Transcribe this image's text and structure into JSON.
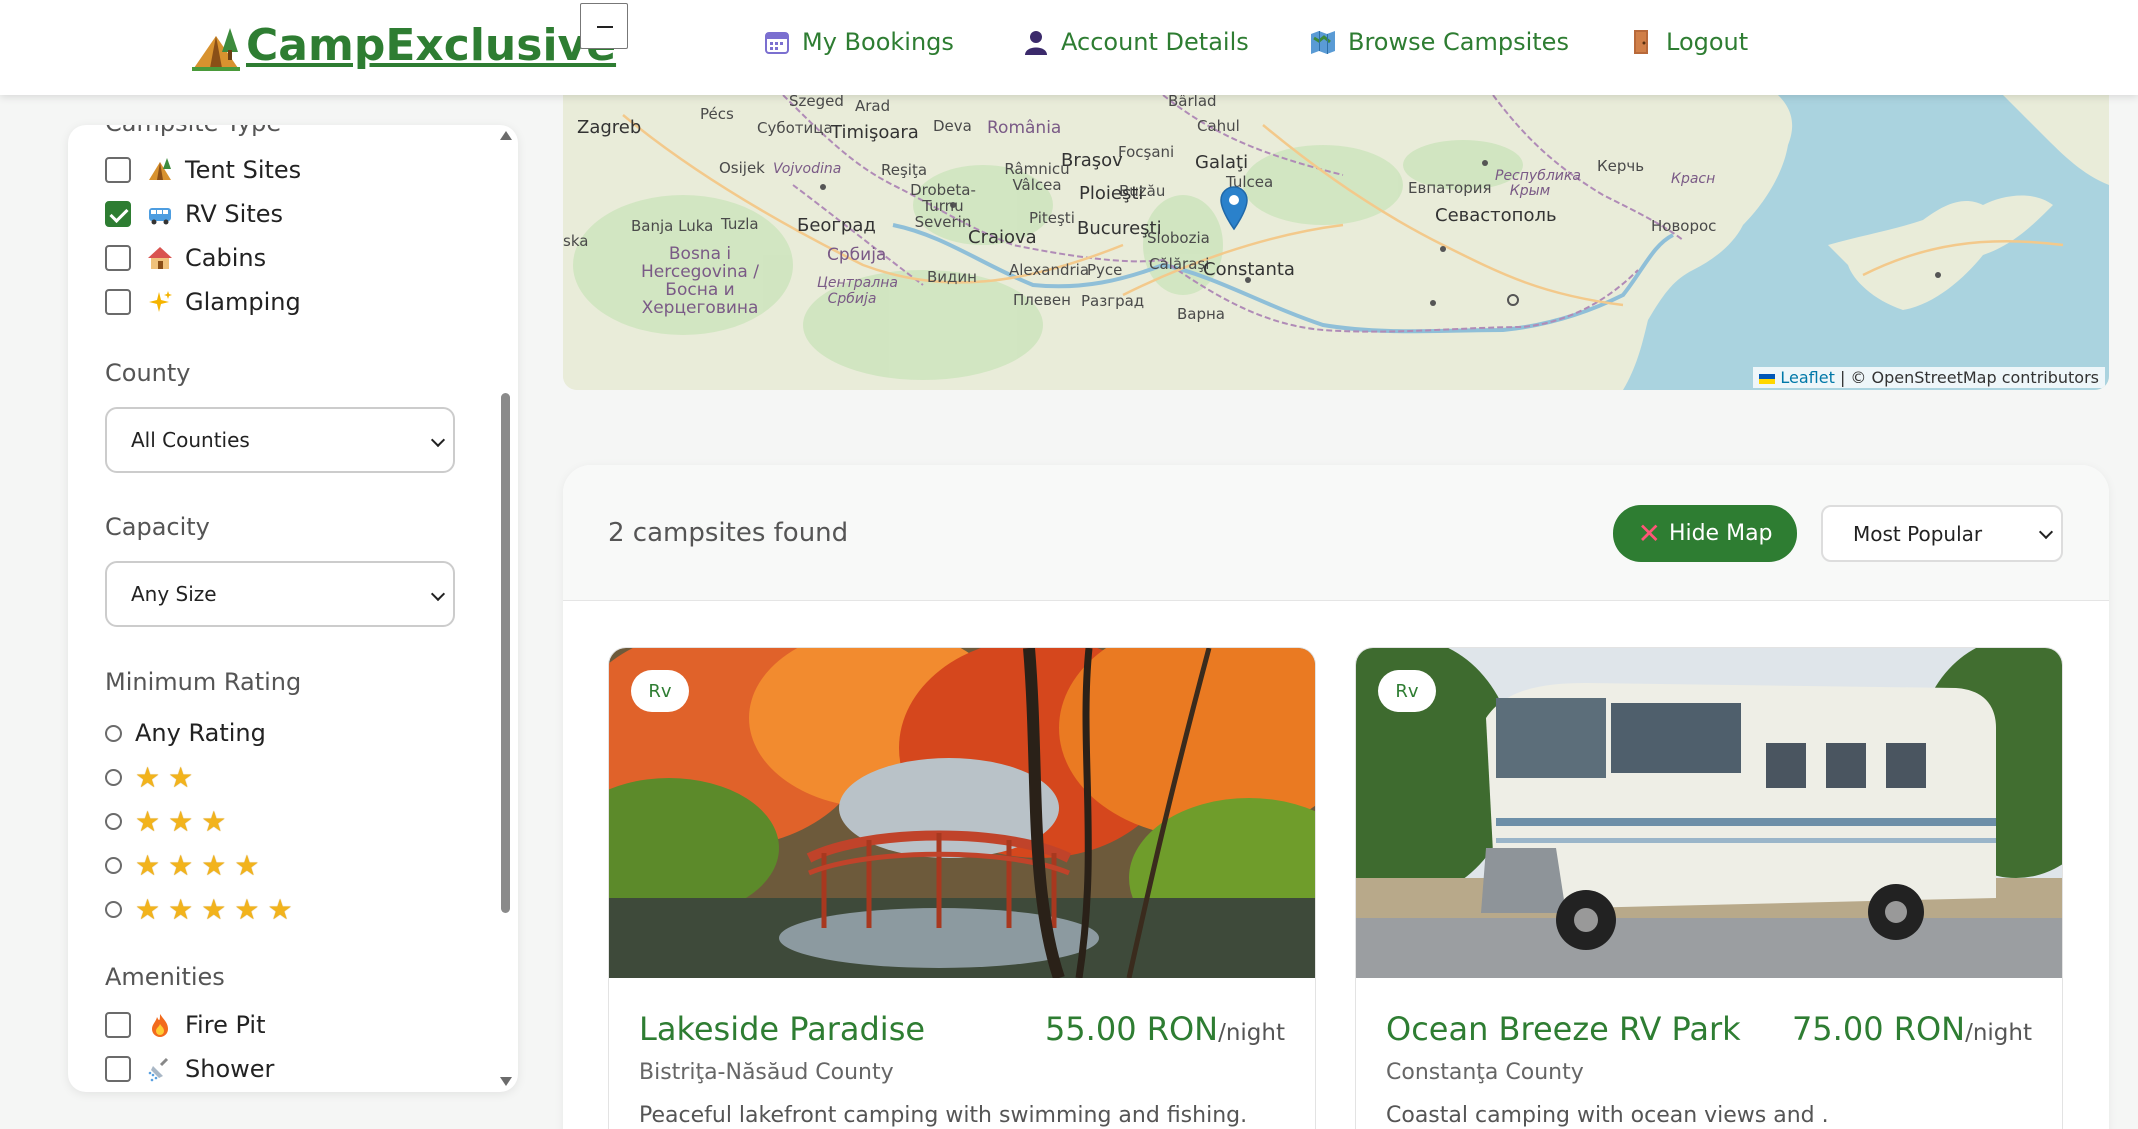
{
  "header": {
    "logo_text": "CampExclusive",
    "zoom_out": "−",
    "nav": [
      {
        "label": "My Bookings",
        "icon": "calendar-icon"
      },
      {
        "label": "Account Details",
        "icon": "person-icon"
      },
      {
        "label": "Browse Campsites",
        "icon": "map-icon"
      },
      {
        "label": "Logout",
        "icon": "door-icon"
      }
    ]
  },
  "map": {
    "labels": [
      "Szeged",
      "Arad",
      "Bârlad",
      "Pécs",
      "Zagreb",
      "Суботица",
      "Timişoara",
      "Deva",
      "România",
      "Cahul",
      "Focşani",
      "Galaţi",
      "Osijek",
      "Vojvodina",
      "Reşiţa",
      "Braşov",
      "Râmnicu Vâlcea",
      "Tulcea",
      "Buzău",
      "Drobeta-Turnu Severin",
      "Ploieşti",
      "Banja Luka",
      "Tuzla",
      "Београд",
      "Craiova",
      "Piteşti",
      "Bucureşti",
      "Slobozia",
      "Bosna i Hercegovina / Босна и Херцеговина",
      "Србија",
      "Видин",
      "Alexandria",
      "Русе",
      "Călăraşi",
      "Constanta",
      "Централна Србија",
      "Плевен",
      "Разград",
      "Варна",
      "Евпатория",
      "Республика Крым",
      "Керчь",
      "Севастополь",
      "Красн",
      "Новорос",
      "ska"
    ],
    "attribution_link": "Leaflet",
    "attribution_text": "| © OpenStreetMap contributors",
    "marker_place": "Constanta"
  },
  "sidebar": {
    "campsite_type_title": "Campsite Type",
    "types": [
      {
        "label": "Tent Sites",
        "checked": false,
        "icon": "tent-icon"
      },
      {
        "label": "RV Sites",
        "checked": true,
        "icon": "bus-icon"
      },
      {
        "label": "Cabins",
        "checked": false,
        "icon": "house-icon"
      },
      {
        "label": "Glamping",
        "checked": false,
        "icon": "sparkles-icon"
      }
    ],
    "county_title": "County",
    "county_value": "All Counties",
    "capacity_title": "Capacity",
    "capacity_value": "Any Size",
    "rating_title": "Minimum Rating",
    "rating_options": [
      "Any Rating",
      "2 stars",
      "3 stars",
      "4 stars",
      "5 stars"
    ],
    "rating_any_label": "Any Rating",
    "amenities_title": "Amenities",
    "amenities": [
      {
        "label": "Fire Pit",
        "checked": false,
        "icon": "fire-icon"
      },
      {
        "label": "Shower",
        "checked": false,
        "icon": "shower-icon"
      }
    ]
  },
  "results": {
    "count_text": "2 campsites found",
    "hide_map_label": "Hide Map",
    "sort_value": "Most Popular",
    "cards": [
      {
        "badge": "Rv",
        "title": "Lakeside Paradise",
        "price": "55.00 RON",
        "unit": "/night",
        "county": "Bistriţa-Năsăud County",
        "description": "Peaceful lakefront camping with swimming and fishing."
      },
      {
        "badge": "Rv",
        "title": "Ocean Breeze RV Park",
        "price": "75.00 RON",
        "unit": "/night",
        "county": "Constanţa County",
        "description": "Coastal camping with ocean views and ."
      }
    ]
  },
  "colors": {
    "brand": "#2e7d32",
    "sea": "#aad3df",
    "land": "#e9ecd9"
  }
}
